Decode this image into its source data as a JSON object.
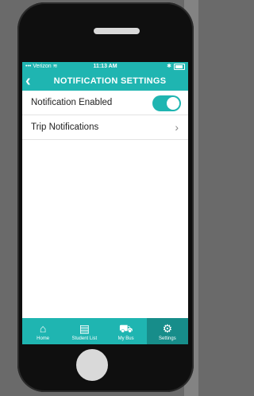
{
  "status": {
    "carrier": "Verizon",
    "time": "11:13 AM"
  },
  "nav": {
    "title": "NOTIFICATION SETTINGS"
  },
  "settings": {
    "items": [
      {
        "label": "Notification Enabled",
        "toggle_on": true
      },
      {
        "label": "Trip Notifications"
      }
    ]
  },
  "tabs": [
    {
      "label": "Home",
      "icon": "home-icon"
    },
    {
      "label": "Student List",
      "icon": "document-icon"
    },
    {
      "label": "My Bus",
      "icon": "bus-icon"
    },
    {
      "label": "Settings",
      "icon": "gear-icon",
      "active": true
    }
  ],
  "colors": {
    "accent": "#1fb5b1",
    "active_tab": "#178d8a"
  }
}
